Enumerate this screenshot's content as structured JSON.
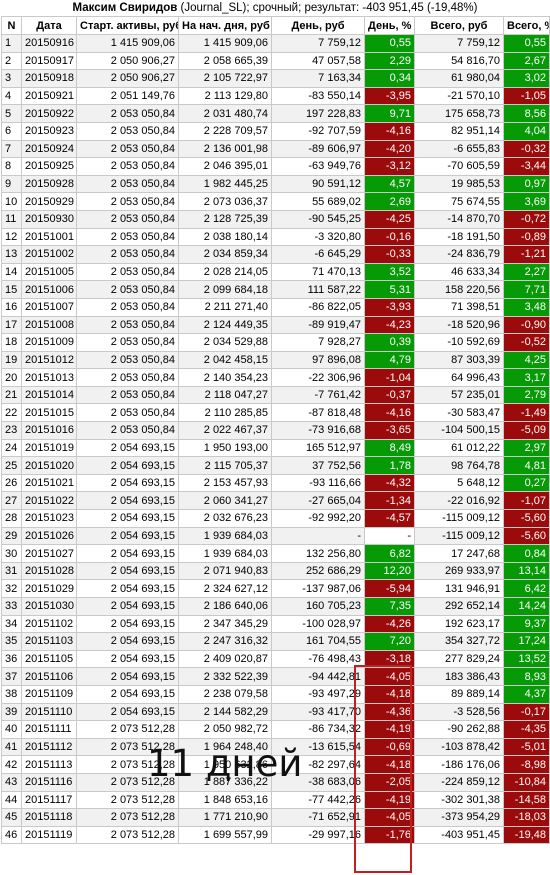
{
  "header": {
    "name": "Максим Свиридов",
    "rest": " (Journal_SL); срочный; результат: -403 951,45 (-19,48%)"
  },
  "columns": [
    "N",
    "Дата",
    "Старт. активы, руб",
    "На нач. дня, руб",
    "День, руб",
    "День, %",
    "Всего, руб",
    "Всего, %"
  ],
  "rows": [
    [
      "1",
      "20150916",
      "1 415 909,06",
      "1 415 909,06",
      "7 759,12",
      "0,55",
      "7 759,12",
      "0,55"
    ],
    [
      "2",
      "20150917",
      "2 050 906,27",
      "2 058 665,39",
      "47 057,58",
      "2,29",
      "54 816,70",
      "2,67"
    ],
    [
      "3",
      "20150918",
      "2 050 906,27",
      "2 105 722,97",
      "7 163,34",
      "0,34",
      "61 980,04",
      "3,02"
    ],
    [
      "4",
      "20150921",
      "2 051 149,76",
      "2 113 129,80",
      "-83 550,14",
      "-3,95",
      "-21 570,10",
      "-1,05"
    ],
    [
      "5",
      "20150922",
      "2 053 050,84",
      "2 031 480,74",
      "197 228,83",
      "9,71",
      "175 658,73",
      "8,56"
    ],
    [
      "6",
      "20150923",
      "2 053 050,84",
      "2 228 709,57",
      "-92 707,59",
      "-4,16",
      "82 951,14",
      "4,04"
    ],
    [
      "7",
      "20150924",
      "2 053 050,84",
      "2 136 001,98",
      "-89 606,97",
      "-4,20",
      "-6 655,83",
      "-0,32"
    ],
    [
      "8",
      "20150925",
      "2 053 050,84",
      "2 046 395,01",
      "-63 949,76",
      "-3,12",
      "-70 605,59",
      "-3,44"
    ],
    [
      "9",
      "20150928",
      "2 053 050,84",
      "1 982 445,25",
      "90 591,12",
      "4,57",
      "19 985,53",
      "0,97"
    ],
    [
      "10",
      "20150929",
      "2 053 050,84",
      "2 073 036,37",
      "55 689,02",
      "2,69",
      "75 674,55",
      "3,69"
    ],
    [
      "11",
      "20150930",
      "2 053 050,84",
      "2 128 725,39",
      "-90 545,25",
      "-4,25",
      "-14 870,70",
      "-0,72"
    ],
    [
      "12",
      "20151001",
      "2 053 050,84",
      "2 038 180,14",
      "-3 320,80",
      "-0,16",
      "-18 191,50",
      "-0,89"
    ],
    [
      "13",
      "20151002",
      "2 053 050,84",
      "2 034 859,34",
      "-6 645,29",
      "-0,33",
      "-24 836,79",
      "-1,21"
    ],
    [
      "14",
      "20151005",
      "2 053 050,84",
      "2 028 214,05",
      "71 470,13",
      "3,52",
      "46 633,34",
      "2,27"
    ],
    [
      "15",
      "20151006",
      "2 053 050,84",
      "2 099 684,18",
      "111 587,22",
      "5,31",
      "158 220,56",
      "7,71"
    ],
    [
      "16",
      "20151007",
      "2 053 050,84",
      "2 211 271,40",
      "-86 822,05",
      "-3,93",
      "71 398,51",
      "3,48"
    ],
    [
      "17",
      "20151008",
      "2 053 050,84",
      "2 124 449,35",
      "-89 919,47",
      "-4,23",
      "-18 520,96",
      "-0,90"
    ],
    [
      "18",
      "20151009",
      "2 053 050,84",
      "2 034 529,88",
      "7 928,27",
      "0,39",
      "-10 592,69",
      "-0,52"
    ],
    [
      "19",
      "20151012",
      "2 053 050,84",
      "2 042 458,15",
      "97 896,08",
      "4,79",
      "87 303,39",
      "4,25"
    ],
    [
      "20",
      "20151013",
      "2 053 050,84",
      "2 140 354,23",
      "-22 306,96",
      "-1,04",
      "64 996,43",
      "3,17"
    ],
    [
      "21",
      "20151014",
      "2 053 050,84",
      "2 118 047,27",
      "-7 761,42",
      "-0,37",
      "57 235,01",
      "2,79"
    ],
    [
      "22",
      "20151015",
      "2 053 050,84",
      "2 110 285,85",
      "-87 818,48",
      "-4,16",
      "-30 583,47",
      "-1,49"
    ],
    [
      "23",
      "20151016",
      "2 053 050,84",
      "2 022 467,37",
      "-73 916,68",
      "-3,65",
      "-104 500,15",
      "-5,09"
    ],
    [
      "24",
      "20151019",
      "2 054 693,15",
      "1 950 193,00",
      "165 512,97",
      "8,49",
      "61 012,22",
      "2,97"
    ],
    [
      "25",
      "20151020",
      "2 054 693,15",
      "2 115 705,37",
      "37 752,56",
      "1,78",
      "98 764,78",
      "4,81"
    ],
    [
      "26",
      "20151021",
      "2 054 693,15",
      "2 153 457,93",
      "-93 116,66",
      "-4,32",
      "5 648,12",
      "0,27"
    ],
    [
      "27",
      "20151022",
      "2 054 693,15",
      "2 060 341,27",
      "-27 665,04",
      "-1,34",
      "-22 016,92",
      "-1,07"
    ],
    [
      "28",
      "20151023",
      "2 054 693,15",
      "2 032 676,23",
      "-92 992,20",
      "-4,57",
      "-115 009,12",
      "-5,60"
    ],
    [
      "29",
      "20151026",
      "2 054 693,15",
      "1 939 684,03",
      "-",
      "-",
      "-115 009,12",
      "-5,60"
    ],
    [
      "30",
      "20151027",
      "2 054 693,15",
      "1 939 684,03",
      "132 256,80",
      "6,82",
      "17 247,68",
      "0,84"
    ],
    [
      "31",
      "20151028",
      "2 054 693,15",
      "2 071 940,83",
      "252 686,29",
      "12,20",
      "269 933,97",
      "13,14"
    ],
    [
      "32",
      "20151029",
      "2 054 693,15",
      "2 324 627,12",
      "-137 987,06",
      "-5,94",
      "131 946,91",
      "6,42"
    ],
    [
      "33",
      "20151030",
      "2 054 693,15",
      "2 186 640,06",
      "160 705,23",
      "7,35",
      "292 652,14",
      "14,24"
    ],
    [
      "34",
      "20151102",
      "2 054 693,15",
      "2 347 345,29",
      "-100 028,97",
      "-4,26",
      "192 623,17",
      "9,37"
    ],
    [
      "35",
      "20151103",
      "2 054 693,15",
      "2 247 316,32",
      "161 704,55",
      "7,20",
      "354 327,72",
      "17,24"
    ],
    [
      "36",
      "20151105",
      "2 054 693,15",
      "2 409 020,87",
      "-76 498,43",
      "-3,18",
      "277 829,24",
      "13,52"
    ],
    [
      "37",
      "20151106",
      "2 054 693,15",
      "2 332 522,39",
      "-94 442,81",
      "-4,05",
      "183 386,43",
      "8,93"
    ],
    [
      "38",
      "20151109",
      "2 054 693,15",
      "2 238 079,58",
      "-93 497,29",
      "-4,18",
      "89 889,14",
      "4,37"
    ],
    [
      "39",
      "20151110",
      "2 054 693,15",
      "2 144 582,29",
      "-93 417,70",
      "-4,36",
      "-3 528,56",
      "-0,17"
    ],
    [
      "40",
      "20151111",
      "2 073 512,28",
      "2 050 982,72",
      "-86 734,32",
      "-4,19",
      "-90 262,88",
      "-4,35"
    ],
    [
      "41",
      "20151112",
      "2 073 512,28",
      "1 964 248,40",
      "-13 615,54",
      "-0,69",
      "-103 878,42",
      "-5,01"
    ],
    [
      "42",
      "20151113",
      "2 073 512,28",
      "1 950 632,86",
      "-82 297,64",
      "-4,18",
      "-186 176,06",
      "-8,98"
    ],
    [
      "43",
      "20151116",
      "2 073 512,28",
      "1 887 336,22",
      "-38 683,06",
      "-2,05",
      "-224 859,12",
      "-10,84"
    ],
    [
      "44",
      "20151117",
      "2 073 512,28",
      "1 848 653,16",
      "-77 442,26",
      "-4,19",
      "-302 301,38",
      "-14,58"
    ],
    [
      "45",
      "20151118",
      "2 073 512,28",
      "1 771 210,90",
      "-71 652,91",
      "-4,05",
      "-373 954,29",
      "-18,03"
    ],
    [
      "46",
      "20151119",
      "2 073 512,28",
      "1 699 557,99",
      "-29 997,16",
      "-1,76",
      "-403 951,45",
      "-19,48"
    ]
  ],
  "overlay_text": "11 дней",
  "colors": {
    "positive": "#079a07",
    "negative": "#9c0b0b",
    "highlight_border": "#c22020"
  }
}
